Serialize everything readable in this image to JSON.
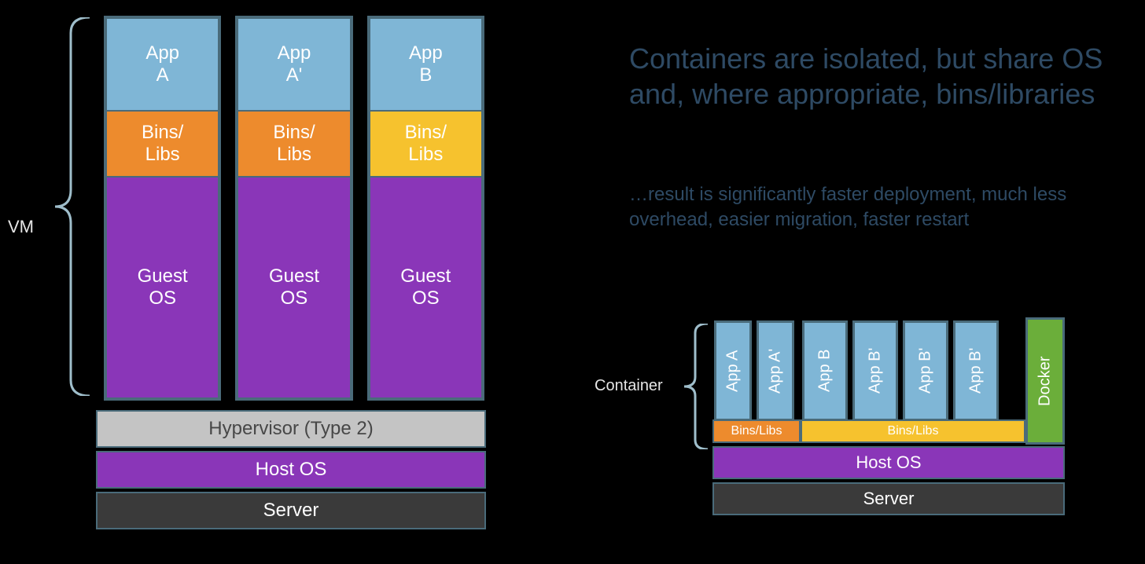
{
  "labels": {
    "vm": "VM",
    "container": "Container"
  },
  "headline": "Containers are isolated, but share OS and, where appropriate, bins/libraries",
  "subtext": "…result is significantly faster deployment, much less overhead, easier migration, faster restart",
  "vm_stack": {
    "columns": [
      {
        "app": "App\nA",
        "bins": "Bins/\nLibs",
        "bins_color": "orange",
        "guest": "Guest\nOS"
      },
      {
        "app": "App\nA'",
        "bins": "Bins/\nLibs",
        "bins_color": "orange",
        "guest": "Guest\nOS"
      },
      {
        "app": "App\nB",
        "bins": "Bins/\nLibs",
        "bins_color": "yellow",
        "guest": "Guest\nOS"
      }
    ],
    "base": {
      "hypervisor": "Hypervisor (Type 2)",
      "host_os": "Host OS",
      "server": "Server"
    }
  },
  "container_stack": {
    "group_a": {
      "apps": [
        "App A",
        "App A'"
      ],
      "bins": "Bins/Libs"
    },
    "group_b": {
      "apps": [
        "App B",
        "App B'",
        "App B'",
        "App B'"
      ],
      "bins": "Bins/Libs"
    },
    "docker": "Docker",
    "base": {
      "host_os": "Host OS",
      "server": "Server"
    }
  },
  "colors": {
    "app_blue": "#7fb6d6",
    "bins_orange": "#ed8b2d",
    "bins_yellow": "#f6c22e",
    "guest_purple": "#8a36b8",
    "hypervisor_gray": "#c4c4c4",
    "server_gray": "#3a3a3a",
    "docker_green": "#6bae3a",
    "frame": "#4a6b7a",
    "text_dark": "#2e4a64"
  }
}
